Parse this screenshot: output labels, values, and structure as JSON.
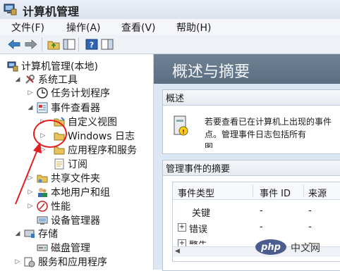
{
  "window": {
    "title": "计算机管理"
  },
  "menu": [
    "文件(F)",
    "操作(A)",
    "查看(V)",
    "帮助(H)"
  ],
  "tree": {
    "root": "计算机管理(本地)",
    "system_tools": "系统工具",
    "task_scheduler": "任务计划程序",
    "event_viewer": "事件查看器",
    "custom_views": "自定义视图",
    "windows_logs": "Windows 日志",
    "app_service_logs": "应用程序和服务",
    "subscriptions": "订阅",
    "shared_folders": "共享文件夹",
    "local_users": "本地用户和组",
    "performance": "性能",
    "device_manager": "设备管理器",
    "storage": "存储",
    "disk_management": "磁盘管理",
    "services_apps": "服务和应用程序"
  },
  "right": {
    "header_title": "概述与摘要",
    "overview_label": "概述",
    "overview_text_1": "若要查看已在计算机上出现的事件",
    "overview_text_2": "点。管理事件日志包括所有",
    "overview_text_3": "图",
    "summary_label": "管理事件的摘要",
    "columns": [
      "事件类型",
      "事件 ID",
      "来源"
    ],
    "rows": [
      {
        "type": "关键",
        "id": "-",
        "src": "-"
      },
      {
        "type": "错误",
        "id": "-",
        "src": "-"
      },
      {
        "type": "警告",
        "id": "-",
        "src": "-"
      }
    ]
  },
  "watermark": {
    "logo": "php",
    "site": "中文网"
  },
  "colors": {
    "annotation": "#e02020",
    "header": "#5c6f82"
  }
}
